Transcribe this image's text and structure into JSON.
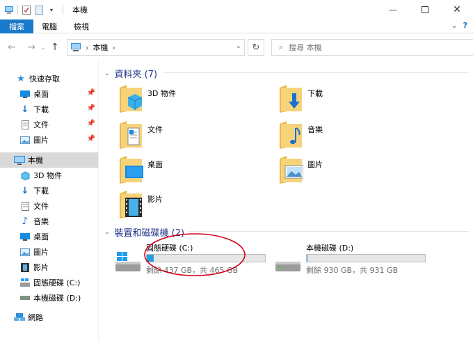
{
  "window": {
    "title": "本機"
  },
  "ribbon": {
    "tabs": [
      "檔案",
      "電腦",
      "檢視"
    ]
  },
  "nav": {
    "breadcrumb": [
      "本機"
    ],
    "search_placeholder": "搜尋 本機"
  },
  "sidebar": {
    "quick_access": "快速存取",
    "quick_items": [
      "桌面",
      "下載",
      "文件",
      "圖片"
    ],
    "this_pc": "本機",
    "pc_items": [
      "3D 物件",
      "下載",
      "文件",
      "音樂",
      "桌面",
      "圖片",
      "影片",
      "固態硬碟 (C:)",
      "本機磁碟 (D:)"
    ],
    "network": "網路"
  },
  "main": {
    "folders_header": "資料夾 (7)",
    "folders": [
      "3D 物件",
      "下載",
      "文件",
      "音樂",
      "桌面",
      "圖片",
      "影片"
    ],
    "drives_header": "裝置和磁碟機 (2)",
    "drives": [
      {
        "name": "固態硬碟 (C:)",
        "size_text": "剩餘 437 GB，共 465 GB",
        "used_fraction": 0.06
      },
      {
        "name": "本機磁碟 (D:)",
        "size_text": "剩餘 930 GB，共 931 GB",
        "used_fraction": 0.001
      }
    ]
  },
  "colors": {
    "accent": "#1979ca",
    "header": "#1e3287",
    "annotation": "#d0021b",
    "drive_fill": "#26a0da"
  }
}
